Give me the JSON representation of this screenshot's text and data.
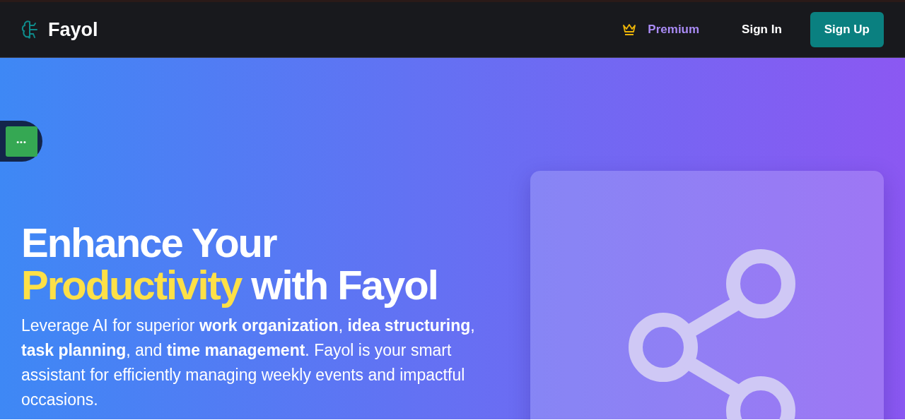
{
  "header": {
    "brand": "Fayol",
    "nav": [
      {
        "kind": "premium",
        "label": "Premium"
      },
      {
        "kind": "link",
        "label": "Sign In"
      },
      {
        "kind": "primary",
        "label": "Sign Up"
      }
    ]
  },
  "floating_button": {
    "label": "•••"
  },
  "hero": {
    "headline": {
      "before": "Enhance Your ",
      "highlight": "Productivity",
      "after": " with Fayol"
    },
    "description": "Leverage AI for superior **work organization**, **idea structuring**, **task planning**, and **time management**. Fayol is your smart assistant for efficiently managing weekly events and impactful occasions."
  }
}
